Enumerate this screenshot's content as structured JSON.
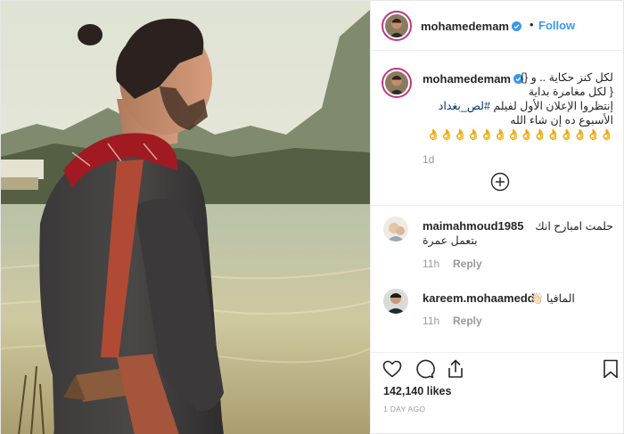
{
  "post": {
    "username": "mohamedemam",
    "verified": true,
    "follow_label": "Follow",
    "separator": "•"
  },
  "caption": {
    "username": "mohamedemam",
    "lines": [
      "لكل كنز حكاية .. و {}",
      "{ لكل مغامرة بداية",
      "إنتظروا الإعلان الأول لفيلم",
      "الأسبوع ده إن شاء الله"
    ],
    "hashtag": "#لص_بغداد",
    "emoji_row": "👌👌👌👌👌👌👌👌👌👌👌👌👌👌",
    "time": "1d"
  },
  "comments": [
    {
      "username": "maimahmoud1985",
      "text_line1": "حلمت امبارح انك",
      "text_line2": "بتعمل عمرة",
      "time": "11h",
      "reply_label": "Reply"
    },
    {
      "username": "kareem.mohaamedd",
      "text": "المافيا 👋🏻",
      "time": "11h",
      "reply_label": "Reply"
    }
  ],
  "actions": {
    "likes_count": "142,140 likes",
    "posted_ago": "1 DAY AGO"
  },
  "icons": {
    "like": "heart-icon",
    "comment": "comment-icon",
    "share": "share-icon",
    "save": "bookmark-icon",
    "load_more": "plus-circle-icon",
    "verified": "verified-badge-icon"
  },
  "colors": {
    "follow": "#3897f0",
    "text": "#262626",
    "muted": "#999999",
    "verified": "#3897f0",
    "story_ring": "#c13584"
  }
}
